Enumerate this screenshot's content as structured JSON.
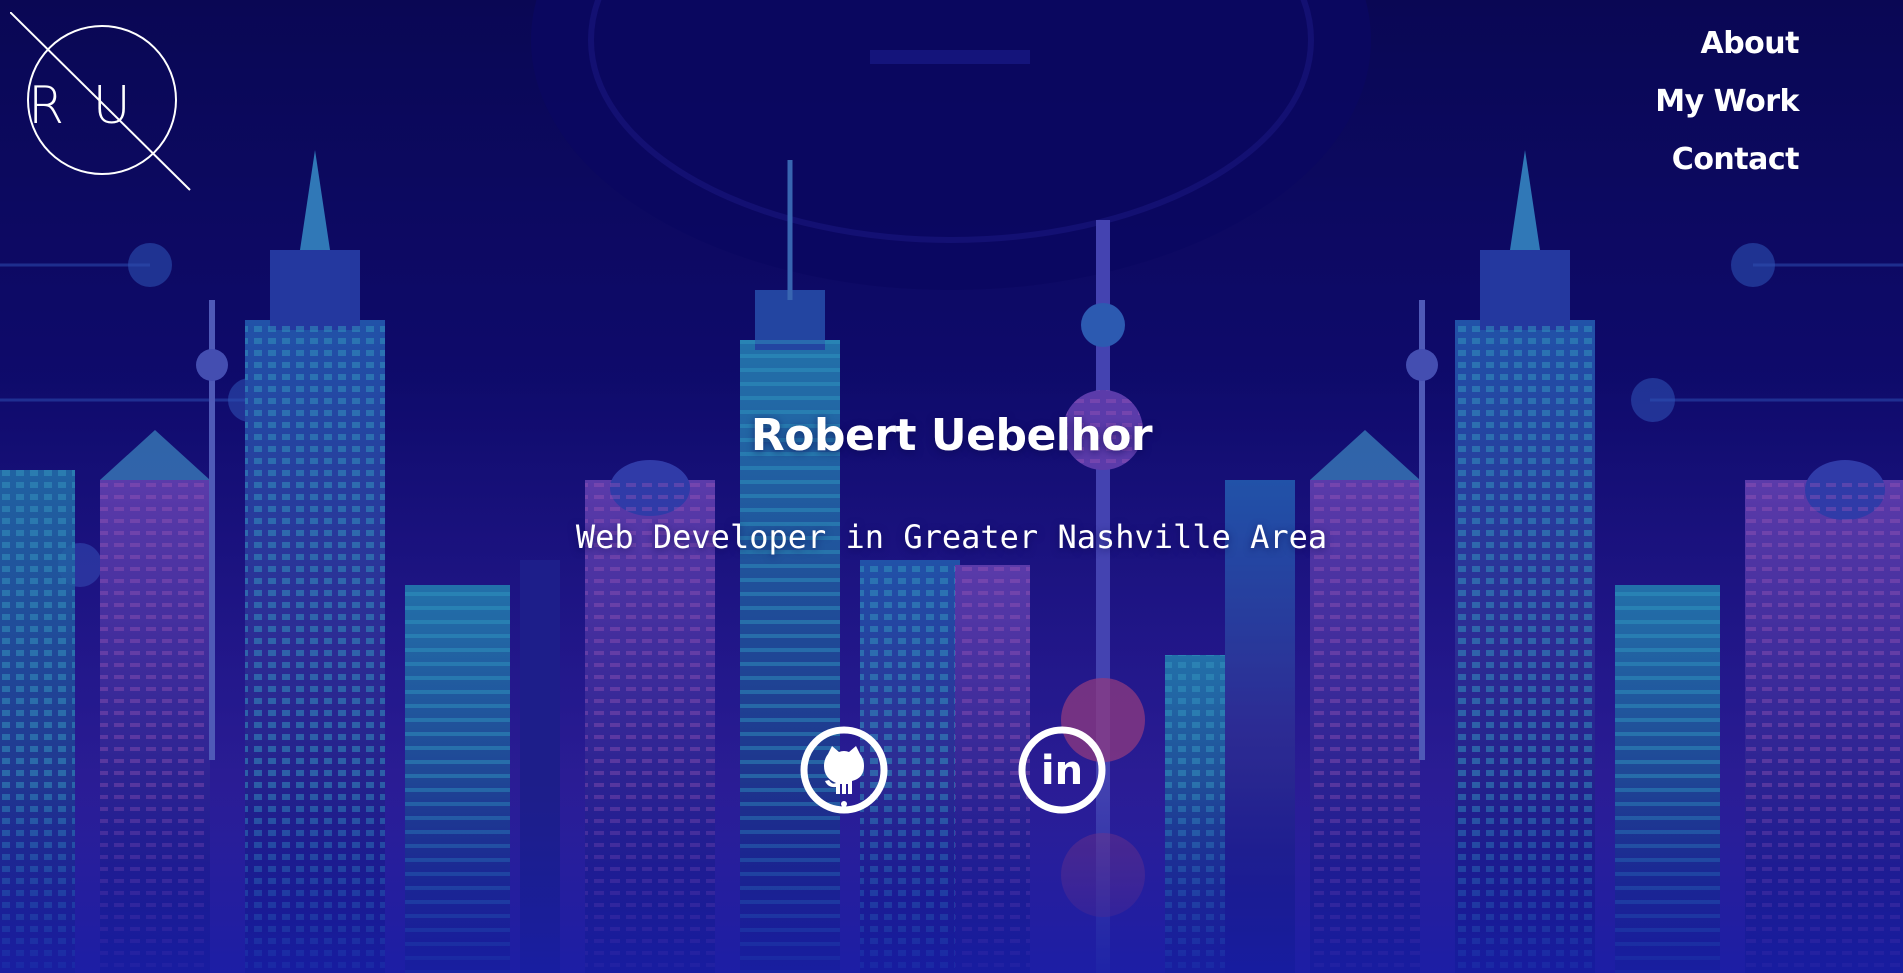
{
  "logo": {
    "initials": "R U"
  },
  "nav": {
    "items": [
      {
        "label": "About"
      },
      {
        "label": "My Work"
      },
      {
        "label": "Contact"
      }
    ]
  },
  "hero": {
    "name": "Robert Uebelhor",
    "tagline": "Web Developer in Greater Nashville Area"
  },
  "social": {
    "github_icon": "github-icon",
    "linkedin_icon": "linkedin-icon",
    "linkedin_text": "in"
  },
  "colors": {
    "background": "#0d0a5e",
    "accent_teal": "#2fb6d4",
    "accent_magenta": "#c24fd3",
    "text": "#ffffff"
  }
}
